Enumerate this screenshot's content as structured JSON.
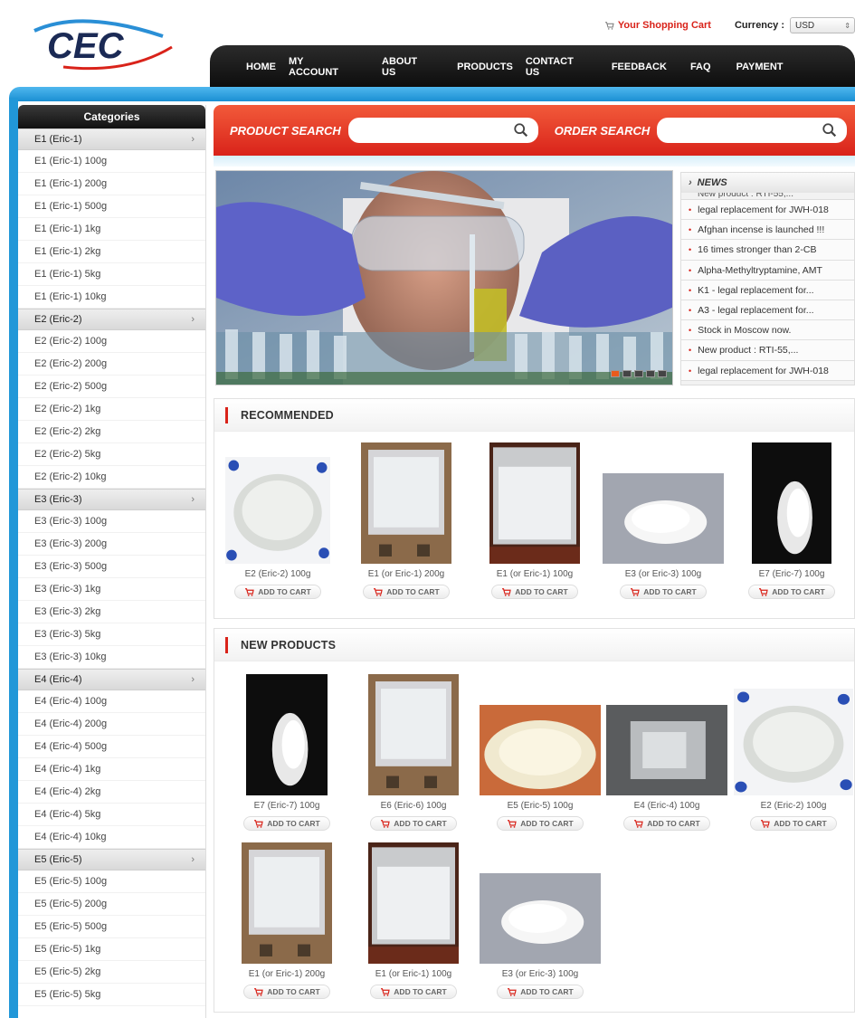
{
  "brand": {
    "logo_text": "CEC"
  },
  "topbar": {
    "cart_label": "Your Shopping Cart",
    "currency_label": "Currency :",
    "currency_value": "USD"
  },
  "nav": {
    "items": [
      {
        "label": "HOME"
      },
      {
        "label": "MY\nACCOUNT"
      },
      {
        "label": "ABOUT\nUS"
      },
      {
        "label": "PRODUCTS"
      },
      {
        "label": "CONTACT\nUS"
      },
      {
        "label": "FEEDBACK"
      },
      {
        "label": "FAQ"
      },
      {
        "label": "PAYMENT"
      }
    ]
  },
  "colors": {
    "accent_red": "#d9231a",
    "nav_black": "#111111",
    "blue_band": "#2197d8"
  },
  "sidebar": {
    "title": "Categories",
    "groups": [
      {
        "label": "E1 (Eric-1)",
        "items": [
          "E1 (Eric-1) 100g",
          "E1 (Eric-1) 200g",
          "E1 (Eric-1) 500g",
          "E1 (Eric-1) 1kg",
          "E1 (Eric-1) 2kg",
          "E1 (Eric-1) 5kg",
          "E1 (Eric-1) 10kg"
        ]
      },
      {
        "label": "E2 (Eric-2)",
        "items": [
          "E2 (Eric-2) 100g",
          "E2 (Eric-2) 200g",
          "E2 (Eric-2) 500g",
          "E2 (Eric-2) 1kg",
          "E2 (Eric-2) 2kg",
          "E2 (Eric-2) 5kg",
          "E2 (Eric-2) 10kg"
        ]
      },
      {
        "label": "E3 (Eric-3)",
        "items": [
          "E3 (Eric-3) 100g",
          "E3 (Eric-3) 200g",
          "E3 (Eric-3) 500g",
          "E3 (Eric-3) 1kg",
          "E3 (Eric-3) 2kg",
          "E3 (Eric-3) 5kg",
          "E3 (Eric-3) 10kg"
        ]
      },
      {
        "label": "E4 (Eric-4)",
        "items": [
          "E4 (Eric-4) 100g",
          "E4 (Eric-4) 200g",
          "E4 (Eric-4) 500g",
          "E4 (Eric-4) 1kg",
          "E4 (Eric-4) 2kg",
          "E4 (Eric-4) 5kg",
          "E4 (Eric-4) 10kg"
        ]
      },
      {
        "label": "E5 (Eric-5)",
        "items": [
          "E5 (Eric-5) 100g",
          "E5 (Eric-5) 200g",
          "E5 (Eric-5) 500g",
          "E5 (Eric-5) 1kg",
          "E5 (Eric-5) 2kg",
          "E5 (Eric-5) 5kg"
        ]
      }
    ]
  },
  "search": {
    "product_label": "PRODUCT SEARCH",
    "order_label": "ORDER SEARCH"
  },
  "news": {
    "title": "NEWS",
    "partial": "New product : RTI-55,...",
    "items": [
      "legal replacement for JWH-018",
      "Afghan incense is launched !!!",
      "16 times stronger than 2-CB",
      "Alpha-Methyltryptamine, AMT",
      "K1 - legal replacement for...",
      "A3 - legal replacement for...",
      "Stock in Moscow now.",
      "New product : RTI-55,...",
      "legal replacement for JWH-018"
    ]
  },
  "recommended": {
    "title": "RECOMMENDED",
    "add_label": "ADD TO CART",
    "products": [
      {
        "name": "E2 (Eric-2) 100g",
        "image": "white-powder-blue-dots"
      },
      {
        "name": "E1 (or Eric-1) 200g",
        "image": "powder-bag-brown"
      },
      {
        "name": "E1 (or Eric-1) 100g",
        "image": "powder-bag-dark"
      },
      {
        "name": "E3 (or Eric-3) 100g",
        "image": "powder-pile-gray"
      },
      {
        "name": "E7 (Eric-7) 100g",
        "image": "crystals-black"
      }
    ]
  },
  "new_products": {
    "title": "NEW PRODUCTS",
    "add_label": "ADD TO CART",
    "products": [
      {
        "name": "E7 (Eric-7) 100g",
        "image": "crystals-black"
      },
      {
        "name": "E6 (Eric-6) 100g",
        "image": "powder-bag-brown"
      },
      {
        "name": "E5 (Eric-5) 100g",
        "image": "powder-hand"
      },
      {
        "name": "E4 (Eric-4) 100g",
        "image": "foil-pack"
      },
      {
        "name": "E2 (Eric-2) 100g",
        "image": "white-powder-blue-dots"
      },
      {
        "name": "E1 (or Eric-1) 200g",
        "image": "powder-bag-brown"
      },
      {
        "name": "E1 (or Eric-1) 100g",
        "image": "powder-bag-dark"
      },
      {
        "name": "E3 (or Eric-3) 100g",
        "image": "powder-pile-gray"
      }
    ]
  }
}
